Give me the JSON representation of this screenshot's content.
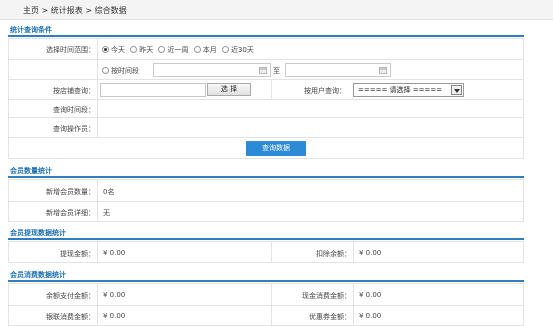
{
  "breadcrumb": "主页 > 统计报表 > 综合数据",
  "query": {
    "title": "统计查询条件",
    "time_range_label": "选择时间范围：",
    "options": [
      "今天",
      "昨天",
      "近一周",
      "本月",
      "近30天"
    ],
    "custom_option": "按时间段",
    "to_label": "至",
    "store_label": "按店铺查询：",
    "select_button": "选 择",
    "user_label": "按用户查询：",
    "user_select_value": "===== 请选择 =====",
    "query_time_label": "查询时间段：",
    "operator_label": "查询操作员：",
    "submit_button": "查询数据"
  },
  "member_stats": {
    "title": "会员数量统计",
    "new_count_label": "新增会员数量：",
    "new_count_value": "0名",
    "new_detail_label": "新增会员详细：",
    "new_detail_value": "无"
  },
  "cash_stats": {
    "title": "会员提现数据统计",
    "withdraw_label": "提现金额：",
    "withdraw_value": "¥ 0.00",
    "deduct_label": "扣除余额：",
    "deduct_value": "¥ 0.00"
  },
  "consume_stats": {
    "title": "会员消费数据统计",
    "balance_pay_label": "余额支付金额：",
    "balance_pay_value": "¥ 0.00",
    "cash_consume_label": "现金消费金额：",
    "cash_consume_value": "¥ 0.00",
    "unionpay_label": "银联消费金额：",
    "unionpay_value": "¥ 0.00",
    "coupon_label": "优惠券金额：",
    "coupon_value": "¥ 0.00"
  }
}
